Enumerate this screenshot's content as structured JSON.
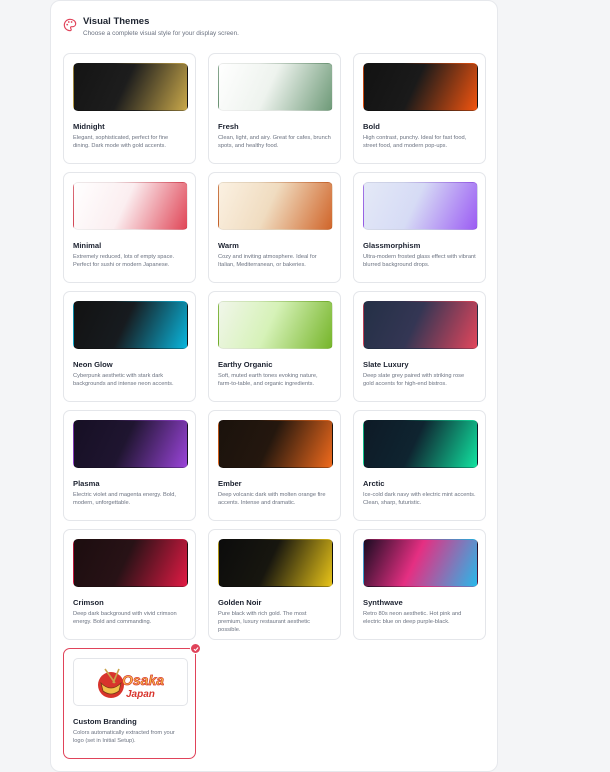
{
  "header": {
    "title": "Visual Themes",
    "subtitle": "Choose a complete visual style for your display screen."
  },
  "themes": [
    {
      "name": "Midnight",
      "desc": "Elegant, sophisticated, perfect for fine dining. Dark mode with gold accents.",
      "gradient": [
        "#141414",
        "#1d1d1d",
        "#c9a84a"
      ]
    },
    {
      "name": "Fresh",
      "desc": "Clean, light, and airy. Great for cafes, brunch spots, and healthy food.",
      "gradient": [
        "#ffffff",
        "#eef3ee",
        "#6e9a78"
      ]
    },
    {
      "name": "Bold",
      "desc": "High contrast, punchy. Ideal for fast food, street food, and modern pop-ups.",
      "gradient": [
        "#121212",
        "#1a1a1a",
        "#f2540f"
      ]
    },
    {
      "name": "Minimal",
      "desc": "Extremely reduced, lots of empty space. Perfect for sushi or modern Japanese.",
      "gradient": [
        "#ffffff",
        "#fbeef0",
        "#e04657"
      ]
    },
    {
      "name": "Warm",
      "desc": "Cozy and inviting atmosphere. Ideal for Italian, Mediterranean, or bakeries.",
      "gradient": [
        "#fbf1e2",
        "#f0dcc0",
        "#d0652a"
      ]
    },
    {
      "name": "Glassmorphism",
      "desc": "Ultra-modern frosted glass effect with vibrant blurred background drops.",
      "gradient": [
        "#e4e9f7",
        "#d6dbf5",
        "#9b5cf3"
      ]
    },
    {
      "name": "Neon Glow",
      "desc": "Cyberpunk aesthetic with stark dark backgrounds and intense neon accents.",
      "gradient": [
        "#121212",
        "#171b1f",
        "#0ab6dd"
      ]
    },
    {
      "name": "Earthy Organic",
      "desc": "Soft, muted earth tones evoking nature, farm-to-table, and organic ingredients.",
      "gradient": [
        "#f1f6ea",
        "#d6f2b8",
        "#76b52a"
      ]
    },
    {
      "name": "Slate Luxury",
      "desc": "Deep slate grey paired with striking rose gold accents for high-end bistros.",
      "gradient": [
        "#243046",
        "#343654",
        "#e2465c"
      ]
    },
    {
      "name": "Plasma",
      "desc": "Electric violet and magenta energy. Bold, modern, unforgettable.",
      "gradient": [
        "#160f24",
        "#1f1530",
        "#9a44d9"
      ]
    },
    {
      "name": "Ember",
      "desc": "Deep volcanic dark with molten orange fire accents. Intense and dramatic.",
      "gradient": [
        "#1a120c",
        "#24170e",
        "#f06a1c"
      ]
    },
    {
      "name": "Arctic",
      "desc": "Ice-cold dark navy with electric mint accents. Clean, sharp, futuristic.",
      "gradient": [
        "#0d1a26",
        "#0f2430",
        "#11e3a0"
      ]
    },
    {
      "name": "Crimson",
      "desc": "Deep dark background with vivid crimson energy. Bold and commanding.",
      "gradient": [
        "#1c0d0f",
        "#281216",
        "#e11a44"
      ]
    },
    {
      "name": "Golden Noir",
      "desc": "Pure black with rich gold. The most premium, luxury restaurant aesthetic possible.",
      "gradient": [
        "#0c0c0c",
        "#17160f",
        "#e8c418"
      ]
    },
    {
      "name": "Synthwave",
      "desc": "Retro 80s neon aesthetic. Hot pink and electric blue on deep purple-black.",
      "gradient": [
        "#1a0c22",
        "#e52f82",
        "#28b8ea"
      ]
    }
  ],
  "custom": {
    "name": "Custom Branding",
    "desc": "Colors automatically extracted from your logo (set in Initial Setup).",
    "logo_line1": "Osaka",
    "logo_line2": "Japan",
    "selected": true
  },
  "colors": {
    "accent": "#e0435a"
  }
}
